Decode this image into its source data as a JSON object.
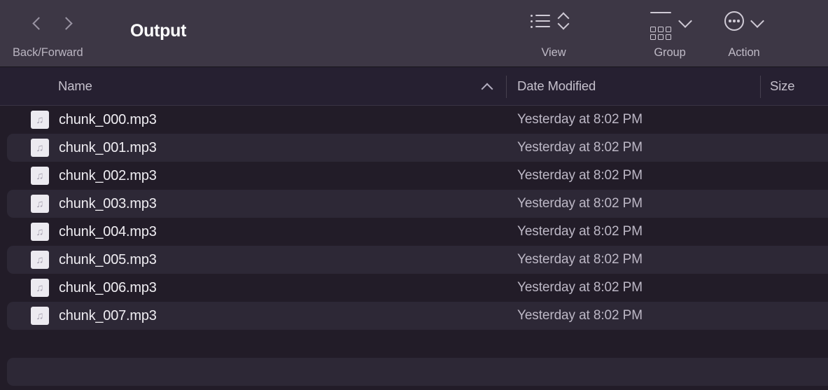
{
  "window": {
    "title": "Output"
  },
  "toolbar": {
    "nav_label": "Back/Forward",
    "back_icon": "chevron-left-icon",
    "forward_icon": "chevron-right-icon",
    "items": [
      {
        "caption": "View",
        "icon": "list-view-icon",
        "secondary_icon": "sort-updown-icon"
      },
      {
        "caption": "Group",
        "icon": "group-grid-icon",
        "secondary_icon": "chevron-down-icon"
      },
      {
        "caption": "Action",
        "icon": "ellipsis-circle-icon",
        "secondary_icon": "chevron-down-icon"
      }
    ]
  },
  "columns": {
    "name": "Name",
    "date_modified": "Date Modified",
    "size": "Size",
    "sort_column": "Name",
    "sort_direction": "ascending",
    "sort_icon": "chevron-up-icon"
  },
  "files": [
    {
      "name": "chunk_000.mp3",
      "date": "Yesterday at 8:02 PM",
      "size": "",
      "icon": "music-note-icon"
    },
    {
      "name": "chunk_001.mp3",
      "date": "Yesterday at 8:02 PM",
      "size": "",
      "icon": "music-note-icon"
    },
    {
      "name": "chunk_002.mp3",
      "date": "Yesterday at 8:02 PM",
      "size": "",
      "icon": "music-note-icon"
    },
    {
      "name": "chunk_003.mp3",
      "date": "Yesterday at 8:02 PM",
      "size": "",
      "icon": "music-note-icon"
    },
    {
      "name": "chunk_004.mp3",
      "date": "Yesterday at 8:02 PM",
      "size": "",
      "icon": "music-note-icon"
    },
    {
      "name": "chunk_005.mp3",
      "date": "Yesterday at 8:02 PM",
      "size": "",
      "icon": "music-note-icon"
    },
    {
      "name": "chunk_006.mp3",
      "date": "Yesterday at 8:02 PM",
      "size": "",
      "icon": "music-note-icon"
    },
    {
      "name": "chunk_007.mp3",
      "date": "Yesterday at 8:02 PM",
      "size": "",
      "icon": "music-note-icon"
    }
  ],
  "icon_glyphs": {
    "music-note-icon": "♫"
  },
  "colors": {
    "toolbar_bg": "#3D3745",
    "header_bg": "#262031",
    "list_bg": "#221C28",
    "row_alt_bg": "#2D2836",
    "text_primary": "#f0eef3",
    "text_secondary": "#bdb8c6",
    "icon_stroke": "#cfcad5"
  }
}
